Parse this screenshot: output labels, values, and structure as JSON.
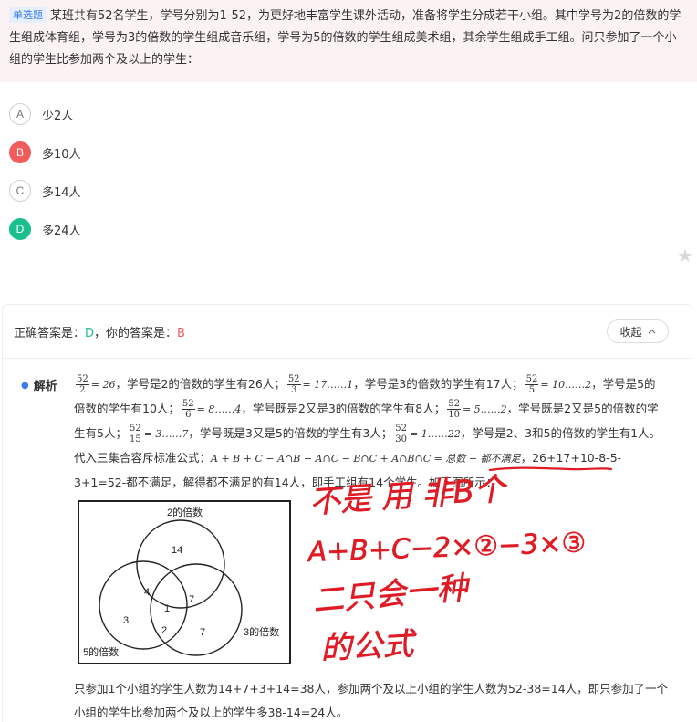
{
  "question": {
    "type_tag": "单选题",
    "text": "某班共有52名学生，学号分别为1-52，为更好地丰富学生课外活动，准备将学生分成若干小组。其中学号为2的倍数的学生组成体育组，学号为3的倍数的学生组成音乐组，学号为5的倍数的学生组成美术组，其余学生组成手工组。问只参加了一个小组的学生比参加两个及以上的学生："
  },
  "options": [
    {
      "letter": "A",
      "label": "少2人",
      "state": "normal"
    },
    {
      "letter": "B",
      "label": "多10人",
      "state": "wrong"
    },
    {
      "letter": "C",
      "label": "多14人",
      "state": "normal"
    },
    {
      "letter": "D",
      "label": "多24人",
      "state": "correct"
    }
  ],
  "favorite_icon": "star-icon",
  "answer": {
    "correct_prefix": "正确答案是：",
    "correct_value": "D",
    "yours_prefix": "，你的答案是：",
    "yours_value": "B",
    "collapse_label": "收起",
    "collapse_icon": "chevron-up-icon"
  },
  "analysis": {
    "label": "解析",
    "frac1": {
      "num": "52",
      "den": "2",
      "result": "= 26"
    },
    "t1": "，学号是2的倍数的学生有26人；",
    "frac2": {
      "num": "52",
      "den": "3",
      "result": "= 17……1"
    },
    "t2": "，学号是3的倍数的学生有17人；",
    "frac3": {
      "num": "52",
      "den": "5",
      "result": "= 10……2"
    },
    "t3": "，学号是5的倍数的学生有10人；",
    "frac4": {
      "num": "52",
      "den": "6",
      "result": "= 8……4"
    },
    "t4": "，学号既是2又是3的倍数的学生有8人；",
    "frac5": {
      "num": "52",
      "den": "10",
      "result": "= 5……2"
    },
    "t5": "，学号既是2又是5的倍数的学生有5人；",
    "frac6": {
      "num": "52",
      "den": "15",
      "result": "= 3……7"
    },
    "t6": "，学号既是3又是5的倍数的学生有3人；",
    "frac7": {
      "num": "52",
      "den": "30",
      "result": "= 1……22"
    },
    "t7": "，学号是2、3和5的倍数的学生有1人。代入三集合容斥标准公式：",
    "formula": "A + B + C − A∩B − A∩C − B∩C + A∩B∩C = 总数 − 都不满足",
    "t8": "，",
    "calc": "26+17+10-8-5-3+1=52",
    "t9": "-都不满足，解得都不满足的有14人，即手工组有14个学生。如下图所示："
  },
  "venn": {
    "label_top": "2的倍数",
    "label_right": "3的倍数",
    "label_left": "5的倍数",
    "regions": {
      "only2": "14",
      "two_five": "4",
      "center": "1",
      "two_three": "7",
      "only5": "3",
      "three_five": "2",
      "only3": "7"
    }
  },
  "conclusion": "只参加1个小组的学生人数为14+7+3+14=38人，参加两个及以上小组的学生人数为52-38=14人，即只参加了一个小组的学生比参加两个及以上的学生多38-14=24人。",
  "handwritten_note": {
    "line1": "不是 用 非B个",
    "line2": "A+B+C−2×②−3×③",
    "line3": "二只会一种",
    "line4": "的公式",
    "ink_color": "#e01b24"
  }
}
